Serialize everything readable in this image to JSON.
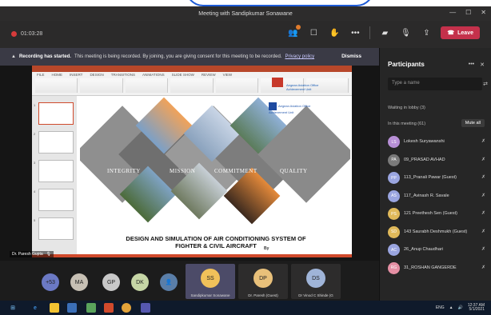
{
  "window": {
    "title": "Meeting with Sandipkumar Sonawane",
    "controls": [
      "—",
      "☐",
      "✕"
    ]
  },
  "toolbar": {
    "recording_time": "01:03:28",
    "leave_label": "Leave",
    "icons": [
      "participants-icon",
      "chat-icon",
      "raise-hand-icon",
      "more-icon",
      "camera-off-icon",
      "mic-off-icon",
      "share-icon"
    ]
  },
  "banner": {
    "bold": "Recording has started.",
    "text": "This meeting is being recorded. By joining, you are giving consent for this meeting to be recorded.",
    "privacy": "Privacy policy",
    "dismiss": "Dismiss"
  },
  "slide": {
    "labels": [
      "INTEGRITY",
      "MISSION",
      "COMMITMENT",
      "QUALITY"
    ],
    "title_line1": "DESIGN AND SIMULATION  OF AIR CONDITIONING SYSTEM OF",
    "title_line2": "FIGHTER & CIVIL AIRCRAFT",
    "by": "By",
    "author": "Dr. Paresh Gupta",
    "logo_text": "Aegean Aviation Office Achievement Unit",
    "presenter_tag": "Dr. Paresh Gupta"
  },
  "strip": {
    "avatars": [
      {
        "initials": "+53",
        "color": "#6b79c4"
      },
      {
        "initials": "MA",
        "color": "#c7c0b4"
      },
      {
        "initials": "GP",
        "color": "#c8c8c8"
      },
      {
        "initials": "DK",
        "color": "#c6d6a6"
      },
      {
        "initials": "👤",
        "color": "#5a7ea8"
      }
    ],
    "tiles": [
      {
        "initials": "SS",
        "color": "#f0c15a",
        "name": "Sandipkumar Sonawane",
        "active": true
      },
      {
        "initials": "DP",
        "color": "#e8c07a",
        "name": "Dr. Paresh (Guest)",
        "active": false
      },
      {
        "initials": "DS",
        "color": "#9fb4d8",
        "name": "Dr Vinod C Shinde (G",
        "active": false
      }
    ]
  },
  "panel": {
    "title": "Participants",
    "search_placeholder": "Type a name",
    "lobby": "Waiting in lobby (3)",
    "in_meeting": "In this meeting (61)",
    "mute_all": "Mute all",
    "people": [
      {
        "initials": "LS",
        "color": "#b78fd6",
        "name": "Lokesh Suryawanshi"
      },
      {
        "initials": "PA",
        "color": "#7a7a7a",
        "name": "09_PRASAD AVHAD"
      },
      {
        "initials": "PP",
        "color": "#9aa5e0",
        "name": "113_Pranali Pawar (Guest)"
      },
      {
        "initials": "AS",
        "color": "#9aa5e0",
        "name": "117_Avinash R. Savale"
      },
      {
        "initials": "PS",
        "color": "#e0b95a",
        "name": "121 Preethesh Sen (Guest)"
      },
      {
        "initials": "SD",
        "color": "#e0b95a",
        "name": "143 Saurabh Deshmukh (Guest)"
      },
      {
        "initials": "AC",
        "color": "#9aa5e0",
        "name": "26_Anup Chaudhari"
      },
      {
        "initials": "RG",
        "color": "#e58fa4",
        "name": "31_ROSHAN GANGERDE"
      }
    ]
  },
  "taskbar": {
    "time": "12:37 AM",
    "date": "5/1/2021",
    "lang": "ENG"
  }
}
